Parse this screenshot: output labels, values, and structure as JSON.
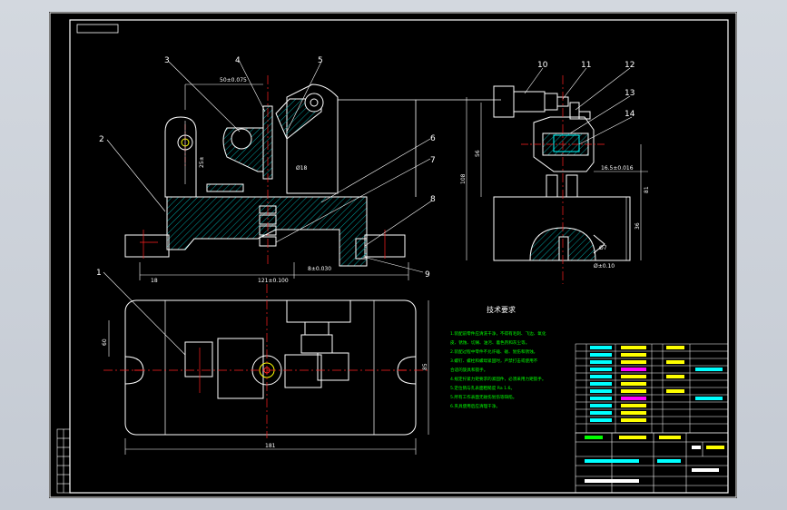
{
  "part_labels": [
    "1",
    "2",
    "3",
    "4",
    "5",
    "6",
    "7",
    "8",
    "9",
    "10",
    "11",
    "12",
    "13",
    "14"
  ],
  "dimensions": {
    "top_view_bore": "50±0.075",
    "top_view_side": "25±",
    "top_view_pin": "Ø18",
    "front_width_left": "18",
    "front_width_total": "121±0.100",
    "front_offset": "8±0.030",
    "right_height_total": "108",
    "right_height_mid": "56",
    "right_height_base": "36",
    "right_height_body": "81",
    "right_fit": "16.5±0.016",
    "right_hole": "Ø7",
    "right_hole2": "Ø±0.10",
    "plan_left": "60",
    "plan_width": "85",
    "plan_length": "181"
  },
  "notes": {
    "title": "技术要求",
    "lines": [
      "1.装配前零件应清洗干净，不得有毛刺、飞边、氧化",
      "皮、锈蚀、切屑、油污、着色剂和灰尘等。",
      "2.装配过程中零件不允许磕、碰、划伤和锈蚀。",
      "3.螺钉、螺栓和螺母紧固时，严禁打击或使用不",
      "合适的旋具和扳手。",
      "4.规定拧紧力矩要求的紧固件，必须采用力矩扳手。",
      "5.定位销与孔表面粗糙度 Ra 1.6。",
      "5.所有工作表面无碰伤划伤等缺陷。",
      "6.夹具使用后应清理干净。"
    ]
  },
  "colors": {
    "line": "#ffffff",
    "hatch": "#00a0a0",
    "leader": "#ffffff",
    "center": "#ff2020",
    "dim": "#ffffff",
    "green": "#00ff00",
    "yellow": "#ffff00",
    "magenta": "#ff00ff",
    "cyan": "#00ffff"
  }
}
